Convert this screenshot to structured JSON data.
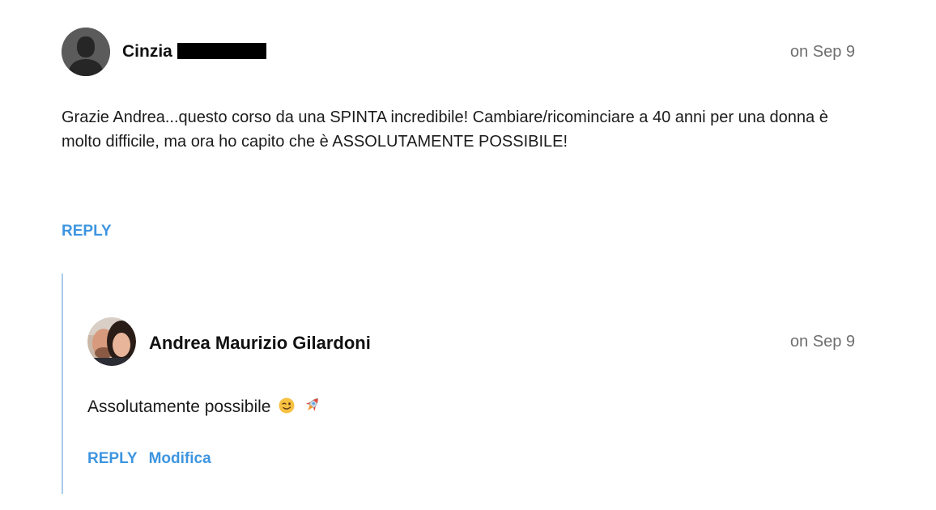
{
  "comments": [
    {
      "author": "Cinzia",
      "date": "on Sep 9",
      "text": "Grazie Andrea...questo corso da una SPINTA incredibile! Cambiare/ricominciare a 40 anni per una donna è molto difficile, ma ora ho capito che è ASSOLUTAMENTE POSSIBILE!",
      "reply_label": "REPLY",
      "avatar_icon": "default-user-avatar-icon",
      "name_redacted": true
    },
    {
      "author": "Andrea Maurizio Gilardoni",
      "date": "on Sep 9",
      "text": "Assolutamente possibile",
      "emojis": [
        "winking-face-emoji",
        "rocket-emoji"
      ],
      "reply_label": "REPLY",
      "edit_label": "Modifica",
      "avatar_icon": "user-photo-avatar"
    }
  ],
  "colors": {
    "link": "#3e95e0",
    "thread_line": "#a9c9e8",
    "date": "#6f6f6f",
    "avatar_default": "#5b5b5b"
  }
}
